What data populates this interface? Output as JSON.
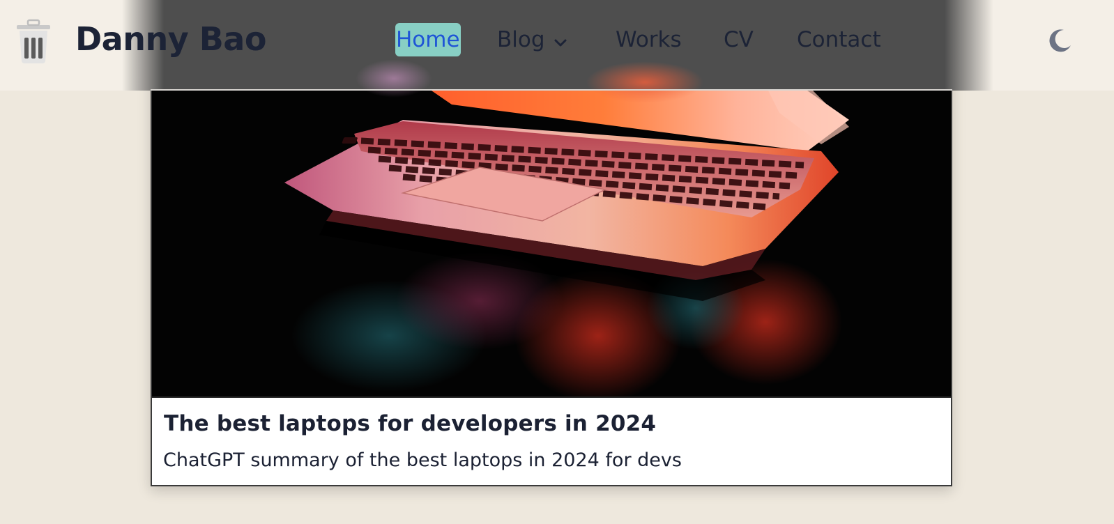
{
  "header": {
    "brand": "Danny Bao",
    "logo_icon": "trash-can-icon",
    "theme_icon": "moon-icon",
    "nav": {
      "home": "Home",
      "blog": "Blog",
      "works": "Works",
      "cv": "CV",
      "contact": "Contact"
    },
    "active_nav": "Home",
    "active_color": "#1f55d6",
    "active_bg": "#88cfc4"
  },
  "post": {
    "title": "The best laptops for developers in 2024",
    "summary": "ChatGPT summary of the best laptops in 2024 for devs",
    "image_alt": "laptop-photo"
  }
}
